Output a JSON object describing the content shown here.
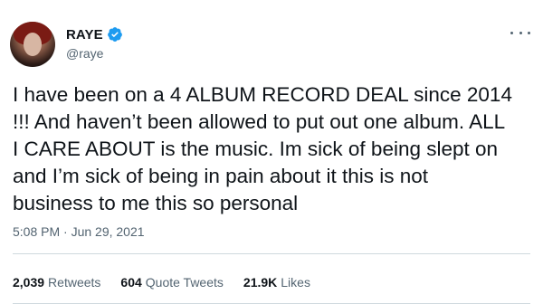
{
  "author": {
    "name": "RAYE",
    "handle": "@raye",
    "verified": true,
    "verified_color": "#1d9bf0"
  },
  "tweet": {
    "text": "I have been on a 4 ALBUM RECORD DEAL since 2014\n!!! And haven’t been allowed to put out one album. ALL\nI CARE ABOUT is the music. Im sick of being slept on\nand I’m sick of being in pain about it this is not\nbusiness to me this so personal",
    "timestamp": "5:08 PM · Jun 29, 2021"
  },
  "stats": [
    {
      "count": "2,039",
      "label": "Retweets"
    },
    {
      "count": "604",
      "label": "Quote Tweets"
    },
    {
      "count": "21.9K",
      "label": "Likes"
    }
  ],
  "icons": {
    "more": "more-options-icon",
    "verified": "verified-badge-icon"
  }
}
